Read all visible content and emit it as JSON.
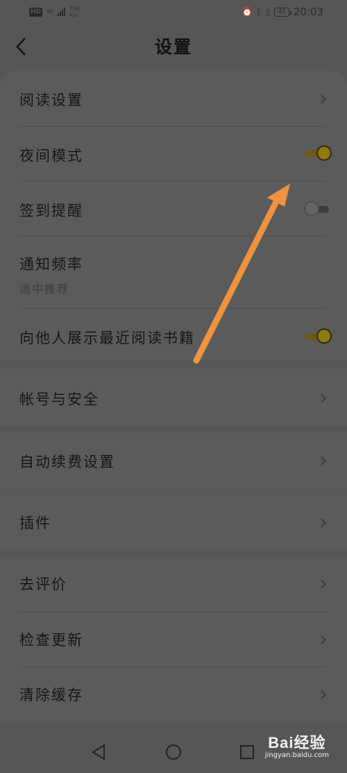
{
  "status_bar": {
    "hd_badge": "HD",
    "network": "4G",
    "speed_value": "788",
    "speed_unit": "K/s",
    "battery": "41",
    "time": "20:03"
  },
  "header": {
    "title": "设置"
  },
  "sections": [
    {
      "rows": [
        {
          "label": "阅读设置",
          "type": "chevron"
        },
        {
          "label": "夜间模式",
          "type": "toggle",
          "on": true
        },
        {
          "label": "签到提醒",
          "type": "toggle",
          "on": false
        },
        {
          "label": "通知频率",
          "sub": "适中推荐",
          "type": "text"
        },
        {
          "label": "向他人展示最近阅读书籍",
          "type": "toggle",
          "on": true
        }
      ]
    },
    {
      "rows": [
        {
          "label": "帐号与安全",
          "type": "chevron"
        }
      ]
    },
    {
      "rows": [
        {
          "label": "自动续费设置",
          "type": "chevron"
        }
      ]
    },
    {
      "rows": [
        {
          "label": "插件",
          "type": "chevron"
        }
      ]
    },
    {
      "rows": [
        {
          "label": "去评价",
          "type": "chevron"
        },
        {
          "label": "检查更新",
          "type": "chevron"
        },
        {
          "label": "清除缓存",
          "type": "chevron"
        }
      ]
    }
  ],
  "annotation": {
    "arrow_color": "#f0923f"
  },
  "watermark": {
    "main": "Bai经验",
    "sub": "jingyan.baidu.com"
  },
  "colors": {
    "toggle_on": "#8e7a10",
    "background": "#565656"
  }
}
